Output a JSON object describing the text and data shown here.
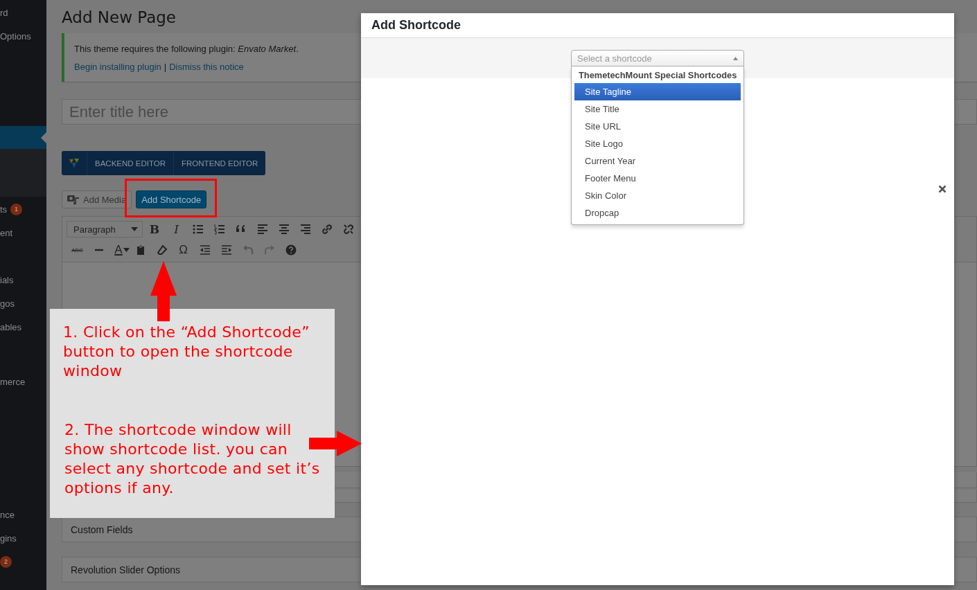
{
  "sidebar": {
    "items": [
      {
        "label": "rd",
        "selected": false
      },
      {
        "label": "Options",
        "selected": false
      },
      {
        "selected": true
      },
      {
        "label": "ts",
        "badge": "1",
        "selected": false
      },
      {
        "label": "ent",
        "selected": false
      },
      {
        "label": "ials",
        "selected": false
      },
      {
        "label": "gos",
        "selected": false
      },
      {
        "label": "ables",
        "selected": false
      },
      {
        "label": "merce",
        "selected": false
      },
      {
        "label": "nce",
        "selected": false
      },
      {
        "label": "gins",
        "selected": false
      },
      {
        "badge": "2",
        "selected": false
      }
    ]
  },
  "page": {
    "title": "Add New Page",
    "notice": {
      "text": "This theme requires the following plugin: *Envato Market*.",
      "links": [
        "Begin installing plugin",
        "Dismiss this notice"
      ],
      "separator": "|"
    },
    "title_field": {
      "placeholder": "Enter title here"
    },
    "editor_switch": {
      "buttons": [
        "BACKEND EDITOR",
        "FRONTEND EDITOR"
      ]
    },
    "media_buttons": [
      {
        "label": "Add Media",
        "kind": "media"
      },
      {
        "label": "Add Shortcode",
        "kind": "primary"
      }
    ],
    "toolbar": {
      "format": "Paragraph",
      "rows": [
        [
          {
            "kind": "bold",
            "text": "B"
          },
          {
            "kind": "italic",
            "text": "I"
          },
          {
            "kind": "bullets"
          },
          {
            "kind": "numbers"
          },
          {
            "kind": "quote"
          },
          {
            "kind": "left"
          },
          {
            "kind": "center"
          },
          {
            "kind": "right"
          },
          {
            "kind": "link"
          },
          {
            "kind": "unlink"
          }
        ],
        [
          {
            "kind": "strike",
            "text": "ABC"
          },
          {
            "kind": "rule"
          },
          {
            "kind": "color",
            "text": "A"
          },
          {
            "kind": "paste"
          },
          {
            "kind": "eraser"
          },
          {
            "kind": "glyph",
            "text": "Ω"
          },
          {
            "kind": "outdent"
          },
          {
            "kind": "indent"
          },
          {
            "kind": "undo"
          },
          {
            "kind": "redo"
          },
          {
            "kind": "help"
          }
        ]
      ]
    },
    "boxes": [
      "Custom Fields",
      "Revolution Slider Options"
    ]
  },
  "modal": {
    "title": "Add Shortcode",
    "select": {
      "placeholder": "Select a shortcode",
      "expanded": true,
      "group": "ThemetechMount Special Shortcodes",
      "options": [
        {
          "label": "Site Tagline",
          "selected": true
        },
        {
          "label": "Site Title",
          "selected": false
        },
        {
          "label": "Site URL",
          "selected": false
        },
        {
          "label": "Site Logo",
          "selected": false
        },
        {
          "label": "Current Year",
          "selected": false
        },
        {
          "label": "Footer Menu",
          "selected": false
        },
        {
          "label": "Skin Color",
          "selected": false
        },
        {
          "label": "Dropcap",
          "selected": false
        }
      ]
    }
  },
  "annotations": {
    "steps": [
      "1. Click on the “Add Shortcode” button to open the shortcode window",
      "2. The shortcode window will show shortcode list. you can select any shortcode and set it’s options if any."
    ]
  }
}
